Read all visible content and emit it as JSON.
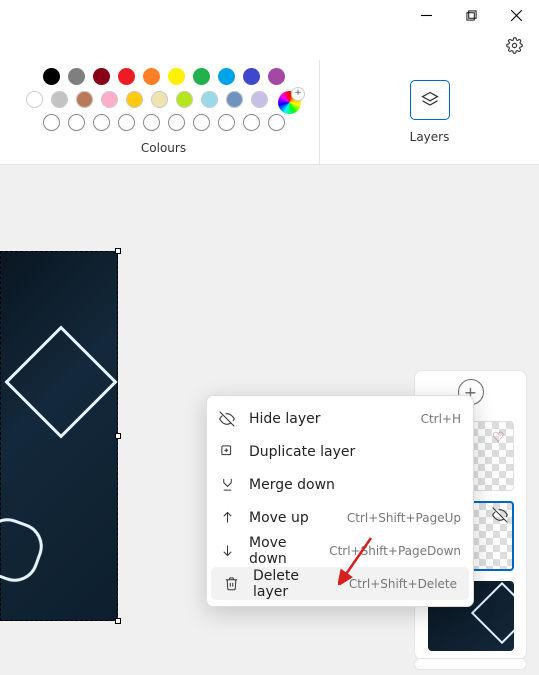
{
  "window_controls": {
    "minimize": "−",
    "maximize": "❐",
    "close": "✕"
  },
  "toolbar": {
    "colours_label": "Colours",
    "layers_label": "Layers",
    "colour_rows": [
      [
        "#000000",
        "#7f7f7f",
        "#880015",
        "#ed1c24",
        "#ff7f27",
        "#fff200",
        "#22b14c",
        "#00a2e8",
        "#3f48cc",
        "#a349a4"
      ],
      [
        "#ffffff",
        "#c3c3c3",
        "#b97a57",
        "#ffaec9",
        "#ffc90e",
        "#efe4b0",
        "#b5e61d",
        "#99d9ea",
        "#7092be",
        "#c8bfe7"
      ]
    ]
  },
  "layers_panel": {
    "add": "+"
  },
  "context_menu": {
    "items": [
      {
        "label": "Hide layer",
        "shortcut": "Ctrl+H",
        "icon": "eye-off"
      },
      {
        "label": "Duplicate layer",
        "shortcut": "",
        "icon": "duplicate"
      },
      {
        "label": "Merge down",
        "shortcut": "",
        "icon": "merge"
      },
      {
        "label": "Move up",
        "shortcut": "Ctrl+Shift+PageUp",
        "icon": "up"
      },
      {
        "label": "Move down",
        "shortcut": "Ctrl+Shift+PageDown",
        "icon": "down"
      },
      {
        "label": "Delete layer",
        "shortcut": "Ctrl+Shift+Delete",
        "icon": "trash"
      }
    ]
  }
}
